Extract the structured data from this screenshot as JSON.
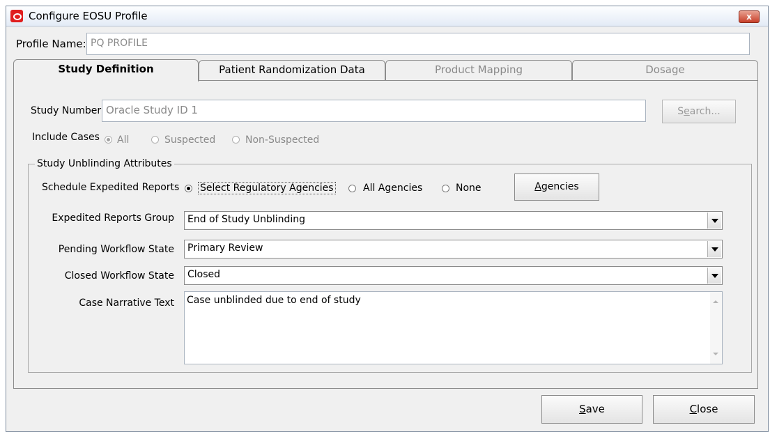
{
  "window": {
    "title": "Configure EOSU Profile",
    "close_glyph": "x"
  },
  "profile": {
    "label": "Profile Name:",
    "value": "PQ PROFILE"
  },
  "tabs": [
    {
      "label": "Study Definition",
      "active": true,
      "enabled": true
    },
    {
      "label": "Patient Randomization Data",
      "active": false,
      "enabled": true
    },
    {
      "label": "Product Mapping",
      "active": false,
      "enabled": false
    },
    {
      "label": "Dosage",
      "active": false,
      "enabled": false
    }
  ],
  "study": {
    "number_label": "Study Number",
    "number_value": "Oracle Study ID 1",
    "search_button": {
      "pre": "S",
      "ul": "e",
      "post": "arch..."
    }
  },
  "include_cases": {
    "label": "Include Cases",
    "options": [
      "All",
      "Suspected",
      "Non-Suspected"
    ],
    "selected": "All"
  },
  "unblinding": {
    "group_title": "Study Unblinding Attributes",
    "schedule_label": "Schedule Expedited Reports",
    "schedule_options": [
      "Select Regulatory Agencies",
      "All Agencies",
      "None"
    ],
    "schedule_selected": "Select Regulatory Agencies",
    "agencies_button": {
      "ul": "A",
      "post": "gencies"
    },
    "reports_group_label": "Expedited Reports Group",
    "reports_group_value": "End of Study Unblinding",
    "pending_label": "Pending Workflow State",
    "pending_value": "Primary Review",
    "closed_label": "Closed Workflow State",
    "closed_value": "Closed",
    "narrative_label": "Case Narrative Text",
    "narrative_value": "Case unblinded due to end of study"
  },
  "footer": {
    "save_button": {
      "ul": "S",
      "post": "ave"
    },
    "close_button": {
      "ul": "C",
      "post": "lose"
    }
  },
  "colors": {
    "window_bg": "#f0f0f0",
    "close_red": "#c8402a",
    "disabled_text": "#8a8a8a"
  }
}
